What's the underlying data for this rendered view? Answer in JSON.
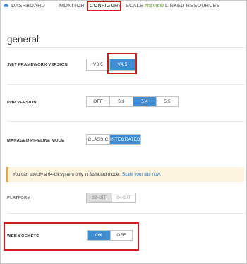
{
  "nav": {
    "items": [
      {
        "label": "DASHBOARD"
      },
      {
        "label": "MONITOR"
      },
      {
        "label": "CONFIGURE"
      },
      {
        "label": "SCALE"
      },
      {
        "label": "LINKED RESOURCES"
      }
    ],
    "preview_badge": "PREVIEW",
    "active_item": "CONFIGURE"
  },
  "section": {
    "title": "general"
  },
  "settings": {
    "net_framework": {
      "label": ".NET FRAMEWORK VERSION",
      "options": [
        "V3.5",
        "V4.5"
      ],
      "selected": "V4.5"
    },
    "php": {
      "label": "PHP VERSION",
      "options": [
        "OFF",
        "5.3",
        "5.4",
        "5.5"
      ],
      "selected": "5.4"
    },
    "pipeline": {
      "label": "MANAGED PIPELINE MODE",
      "options": [
        "CLASSIC",
        "INTEGRATED"
      ],
      "selected": "INTEGRATED"
    },
    "platform": {
      "label": "PLATFORM",
      "options": [
        "32-BIT",
        "64-BIT"
      ],
      "selected": "32-BIT",
      "disabled": true
    },
    "web_sockets": {
      "label": "WEB SOCKETS",
      "options": [
        "ON",
        "OFF"
      ],
      "selected": "ON"
    }
  },
  "notice": {
    "text": "You can specify a 64-bit system only in Standard mode.",
    "link": "Scale your site now."
  },
  "colors": {
    "accent": "#3f8ed4",
    "highlight_outline": "#cc1f1f",
    "notice_bg": "#fdf4e0",
    "notice_bar": "#f1a33b",
    "preview_green": "#7aa33a"
  }
}
